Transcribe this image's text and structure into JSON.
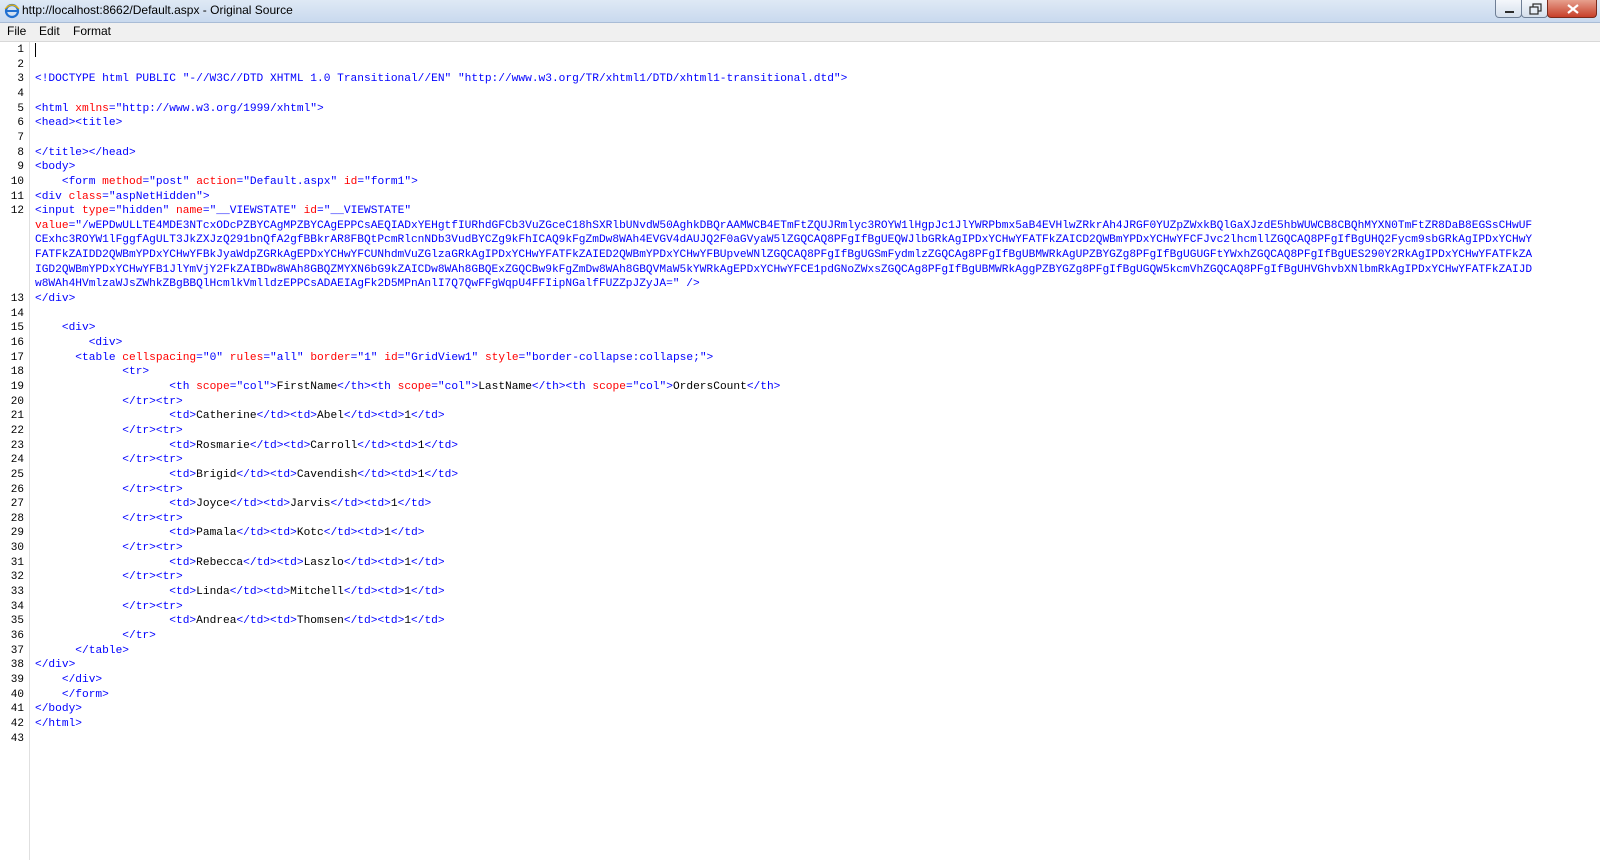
{
  "window": {
    "title": "http://localhost:8662/Default.aspx - Original Source"
  },
  "menu": {
    "items": [
      "File",
      "Edit",
      "Format"
    ]
  },
  "colors": {
    "tag": "#0000ff",
    "attr_name": "#ff0000",
    "attr_value": "#0000ff",
    "text": "#000000"
  },
  "icons": {
    "app": "ie-icon",
    "minimize": "minimize-icon",
    "maximize": "maximize-icon",
    "close": "close-icon"
  },
  "lines": [
    {
      "n": "1",
      "seg": []
    },
    {
      "n": "2",
      "seg": []
    },
    {
      "n": "3",
      "seg": [
        [
          "t",
          "<!DOCTYPE html PUBLIC "
        ],
        [
          "v",
          "\"-//W3C//DTD XHTML 1.0 Transitional//EN\""
        ],
        [
          "t",
          " "
        ],
        [
          "v",
          "\"http://www.w3.org/TR/xhtml1/DTD/xhtml1-transitional.dtd\""
        ],
        [
          "t",
          ">"
        ]
      ]
    },
    {
      "n": "4",
      "seg": []
    },
    {
      "n": "5",
      "seg": [
        [
          "t",
          "<html "
        ],
        [
          "a",
          "xmlns"
        ],
        [
          "t",
          "="
        ],
        [
          "v",
          "\"http://www.w3.org/1999/xhtml\""
        ],
        [
          "t",
          ">"
        ]
      ]
    },
    {
      "n": "6",
      "seg": [
        [
          "t",
          "<head><title>"
        ]
      ]
    },
    {
      "n": "7",
      "seg": []
    },
    {
      "n": "8",
      "seg": [
        [
          "t",
          "</title></head>"
        ]
      ]
    },
    {
      "n": "9",
      "seg": [
        [
          "t",
          "<body>"
        ]
      ]
    },
    {
      "n": "10",
      "seg": [
        [
          "x",
          "    "
        ],
        [
          "t",
          "<form "
        ],
        [
          "a",
          "method"
        ],
        [
          "t",
          "="
        ],
        [
          "v",
          "\"post\""
        ],
        [
          "t",
          " "
        ],
        [
          "a",
          "action"
        ],
        [
          "t",
          "="
        ],
        [
          "v",
          "\"Default.aspx\""
        ],
        [
          "t",
          " "
        ],
        [
          "a",
          "id"
        ],
        [
          "t",
          "="
        ],
        [
          "v",
          "\"form1\""
        ],
        [
          "t",
          ">"
        ]
      ]
    },
    {
      "n": "11",
      "seg": [
        [
          "t",
          "<div "
        ],
        [
          "a",
          "class"
        ],
        [
          "t",
          "="
        ],
        [
          "v",
          "\"aspNetHidden\""
        ],
        [
          "t",
          ">"
        ]
      ]
    },
    {
      "n": "12",
      "seg": [
        [
          "t",
          "<input "
        ],
        [
          "a",
          "type"
        ],
        [
          "t",
          "="
        ],
        [
          "v",
          "\"hidden\""
        ],
        [
          "t",
          " "
        ],
        [
          "a",
          "name"
        ],
        [
          "t",
          "="
        ],
        [
          "v",
          "\"__VIEWSTATE\""
        ],
        [
          "t",
          " "
        ],
        [
          "a",
          "id"
        ],
        [
          "t",
          "="
        ],
        [
          "v",
          "\"__VIEWSTATE\""
        ]
      ]
    },
    {
      "n": "",
      "seg": [
        [
          "a",
          "value"
        ],
        [
          "t",
          "="
        ],
        [
          "v",
          "\"/wEPDwULLTE4MDE3NTcxODcPZBYCAgMPZBYCAgEPPCsAEQIADxYEHgtfIURhdGFCb3VuZGceC18hSXRlbUNvdW50AghkDBQrAAMWCB4ETmFtZQUJRmlyc3ROYW1lHgpJc1JlYWRPbmx5aB4EVHlwZRkrAh4JRGF0YUZpZWxkBQlGaXJzdE5hbWUWCB8CBQhMYXN0TmFtZR8DaB8EGSsCHwUF"
        ]
      ]
    },
    {
      "n": "",
      "seg": [
        [
          "v",
          "CExhc3ROYW1lFggfAgULT3JkZXJzQ291bnQfA2gfBBkrAR8FBQtPcmRlcnNDb3VudBYCZg9kFhICAQ9kFgZmDw8WAh4EVGV4dAUJQ2F0aGVyaW5lZGQCAQ8PFgIfBgUEQWJlbGRkAgIPDxYCHwYFATFkZAICD2QWBmYPDxYCHwYFCFJvc2lhcmllZGQCAQ8PFgIfBgUHQ2Fycm9sbGRkAgIPDxYCHwY"
        ]
      ]
    },
    {
      "n": "",
      "seg": [
        [
          "v",
          "FATFkZAIDD2QWBmYPDxYCHwYFBkJyaWdpZGRkAgEPDxYCHwYFCUNhdmVuZGlzaGRkAgIPDxYCHwYFATFkZAIED2QWBmYPDxYCHwYFBUpveWNlZGQCAQ8PFgIfBgUGSmFydmlzZGQCAg8PFgIfBgUBMWRkAgUPZBYGZg8PFgIfBgUGUGFtYWxhZGQCAQ8PFgIfBgUES290Y2RkAgIPDxYCHwYFATFkZA"
        ]
      ]
    },
    {
      "n": "",
      "seg": [
        [
          "v",
          "IGD2QWBmYPDxYCHwYFB1JlYmVjY2FkZAIBDw8WAh8GBQZMYXN6bG9kZAICDw8WAh8GBQExZGQCBw9kFgZmDw8WAh8GBQVMaW5kYWRkAgEPDxYCHwYFCE1pdGNoZWxsZGQCAg8PFgIfBgUBMWRkAggPZBYGZg8PFgIfBgUGQW5kcmVhZGQCAQ8PFgIfBgUHVGhvbXNlbmRkAgIPDxYCHwYFATFkZAIJD"
        ]
      ]
    },
    {
      "n": "",
      "seg": [
        [
          "v",
          "w8WAh4HVmlzaWJsZWhkZBgBBQlHcmlkVmlldzEPPCsADAEIAgFk2D5MPnAnlI7Q7QwFFgWqpU4FFIipNGalfFUZZpJZyJA=\""
        ],
        [
          "t",
          " />"
        ]
      ]
    },
    {
      "n": "13",
      "seg": [
        [
          "t",
          "</div>"
        ]
      ]
    },
    {
      "n": "14",
      "seg": []
    },
    {
      "n": "15",
      "seg": [
        [
          "x",
          "    "
        ],
        [
          "t",
          "<div>"
        ]
      ]
    },
    {
      "n": "16",
      "seg": [
        [
          "x",
          "        "
        ],
        [
          "t",
          "<div>"
        ]
      ]
    },
    {
      "n": "17",
      "seg": [
        [
          "x",
          "      "
        ],
        [
          "t",
          "<table "
        ],
        [
          "a",
          "cellspacing"
        ],
        [
          "t",
          "="
        ],
        [
          "v",
          "\"0\""
        ],
        [
          "t",
          " "
        ],
        [
          "a",
          "rules"
        ],
        [
          "t",
          "="
        ],
        [
          "v",
          "\"all\""
        ],
        [
          "t",
          " "
        ],
        [
          "a",
          "border"
        ],
        [
          "t",
          "="
        ],
        [
          "v",
          "\"1\""
        ],
        [
          "t",
          " "
        ],
        [
          "a",
          "id"
        ],
        [
          "t",
          "="
        ],
        [
          "v",
          "\"GridView1\""
        ],
        [
          "t",
          " "
        ],
        [
          "a",
          "style"
        ],
        [
          "t",
          "="
        ],
        [
          "v",
          "\"border-collapse:collapse;\""
        ],
        [
          "t",
          ">"
        ]
      ]
    },
    {
      "n": "18",
      "seg": [
        [
          "x",
          "             "
        ],
        [
          "t",
          "<tr>"
        ]
      ]
    },
    {
      "n": "19",
      "seg": [
        [
          "x",
          "                    "
        ],
        [
          "t",
          "<th "
        ],
        [
          "a",
          "scope"
        ],
        [
          "t",
          "="
        ],
        [
          "v",
          "\"col\""
        ],
        [
          "t",
          ">"
        ],
        [
          "x",
          "FirstName"
        ],
        [
          "t",
          "</th><th "
        ],
        [
          "a",
          "scope"
        ],
        [
          "t",
          "="
        ],
        [
          "v",
          "\"col\""
        ],
        [
          "t",
          ">"
        ],
        [
          "x",
          "LastName"
        ],
        [
          "t",
          "</th><th "
        ],
        [
          "a",
          "scope"
        ],
        [
          "t",
          "="
        ],
        [
          "v",
          "\"col\""
        ],
        [
          "t",
          ">"
        ],
        [
          "x",
          "OrdersCount"
        ],
        [
          "t",
          "</th>"
        ]
      ]
    },
    {
      "n": "20",
      "seg": [
        [
          "x",
          "             "
        ],
        [
          "t",
          "</tr><tr>"
        ]
      ]
    },
    {
      "n": "21",
      "seg": [
        [
          "x",
          "                    "
        ],
        [
          "t",
          "<td>"
        ],
        [
          "x",
          "Catherine"
        ],
        [
          "t",
          "</td><td>"
        ],
        [
          "x",
          "Abel"
        ],
        [
          "t",
          "</td><td>"
        ],
        [
          "x",
          "1"
        ],
        [
          "t",
          "</td>"
        ]
      ]
    },
    {
      "n": "22",
      "seg": [
        [
          "x",
          "             "
        ],
        [
          "t",
          "</tr><tr>"
        ]
      ]
    },
    {
      "n": "23",
      "seg": [
        [
          "x",
          "                    "
        ],
        [
          "t",
          "<td>"
        ],
        [
          "x",
          "Rosmarie"
        ],
        [
          "t",
          "</td><td>"
        ],
        [
          "x",
          "Carroll"
        ],
        [
          "t",
          "</td><td>"
        ],
        [
          "x",
          "1"
        ],
        [
          "t",
          "</td>"
        ]
      ]
    },
    {
      "n": "24",
      "seg": [
        [
          "x",
          "             "
        ],
        [
          "t",
          "</tr><tr>"
        ]
      ]
    },
    {
      "n": "25",
      "seg": [
        [
          "x",
          "                    "
        ],
        [
          "t",
          "<td>"
        ],
        [
          "x",
          "Brigid"
        ],
        [
          "t",
          "</td><td>"
        ],
        [
          "x",
          "Cavendish"
        ],
        [
          "t",
          "</td><td>"
        ],
        [
          "x",
          "1"
        ],
        [
          "t",
          "</td>"
        ]
      ]
    },
    {
      "n": "26",
      "seg": [
        [
          "x",
          "             "
        ],
        [
          "t",
          "</tr><tr>"
        ]
      ]
    },
    {
      "n": "27",
      "seg": [
        [
          "x",
          "                    "
        ],
        [
          "t",
          "<td>"
        ],
        [
          "x",
          "Joyce"
        ],
        [
          "t",
          "</td><td>"
        ],
        [
          "x",
          "Jarvis"
        ],
        [
          "t",
          "</td><td>"
        ],
        [
          "x",
          "1"
        ],
        [
          "t",
          "</td>"
        ]
      ]
    },
    {
      "n": "28",
      "seg": [
        [
          "x",
          "             "
        ],
        [
          "t",
          "</tr><tr>"
        ]
      ]
    },
    {
      "n": "29",
      "seg": [
        [
          "x",
          "                    "
        ],
        [
          "t",
          "<td>"
        ],
        [
          "x",
          "Pamala"
        ],
        [
          "t",
          "</td><td>"
        ],
        [
          "x",
          "Kotc"
        ],
        [
          "t",
          "</td><td>"
        ],
        [
          "x",
          "1"
        ],
        [
          "t",
          "</td>"
        ]
      ]
    },
    {
      "n": "30",
      "seg": [
        [
          "x",
          "             "
        ],
        [
          "t",
          "</tr><tr>"
        ]
      ]
    },
    {
      "n": "31",
      "seg": [
        [
          "x",
          "                    "
        ],
        [
          "t",
          "<td>"
        ],
        [
          "x",
          "Rebecca"
        ],
        [
          "t",
          "</td><td>"
        ],
        [
          "x",
          "Laszlo"
        ],
        [
          "t",
          "</td><td>"
        ],
        [
          "x",
          "1"
        ],
        [
          "t",
          "</td>"
        ]
      ]
    },
    {
      "n": "32",
      "seg": [
        [
          "x",
          "             "
        ],
        [
          "t",
          "</tr><tr>"
        ]
      ]
    },
    {
      "n": "33",
      "seg": [
        [
          "x",
          "                    "
        ],
        [
          "t",
          "<td>"
        ],
        [
          "x",
          "Linda"
        ],
        [
          "t",
          "</td><td>"
        ],
        [
          "x",
          "Mitchell"
        ],
        [
          "t",
          "</td><td>"
        ],
        [
          "x",
          "1"
        ],
        [
          "t",
          "</td>"
        ]
      ]
    },
    {
      "n": "34",
      "seg": [
        [
          "x",
          "             "
        ],
        [
          "t",
          "</tr><tr>"
        ]
      ]
    },
    {
      "n": "35",
      "seg": [
        [
          "x",
          "                    "
        ],
        [
          "t",
          "<td>"
        ],
        [
          "x",
          "Andrea"
        ],
        [
          "t",
          "</td><td>"
        ],
        [
          "x",
          "Thomsen"
        ],
        [
          "t",
          "</td><td>"
        ],
        [
          "x",
          "1"
        ],
        [
          "t",
          "</td>"
        ]
      ]
    },
    {
      "n": "36",
      "seg": [
        [
          "x",
          "             "
        ],
        [
          "t",
          "</tr>"
        ]
      ]
    },
    {
      "n": "37",
      "seg": [
        [
          "x",
          "      "
        ],
        [
          "t",
          "</table>"
        ]
      ]
    },
    {
      "n": "38",
      "seg": [
        [
          "t",
          "</div>"
        ]
      ]
    },
    {
      "n": "39",
      "seg": [
        [
          "x",
          "    "
        ],
        [
          "t",
          "</div>"
        ]
      ]
    },
    {
      "n": "40",
      "seg": [
        [
          "x",
          "    "
        ],
        [
          "t",
          "</form>"
        ]
      ]
    },
    {
      "n": "41",
      "seg": [
        [
          "t",
          "</body>"
        ]
      ]
    },
    {
      "n": "42",
      "seg": [
        [
          "t",
          "</html>"
        ]
      ]
    },
    {
      "n": "43",
      "seg": []
    }
  ]
}
